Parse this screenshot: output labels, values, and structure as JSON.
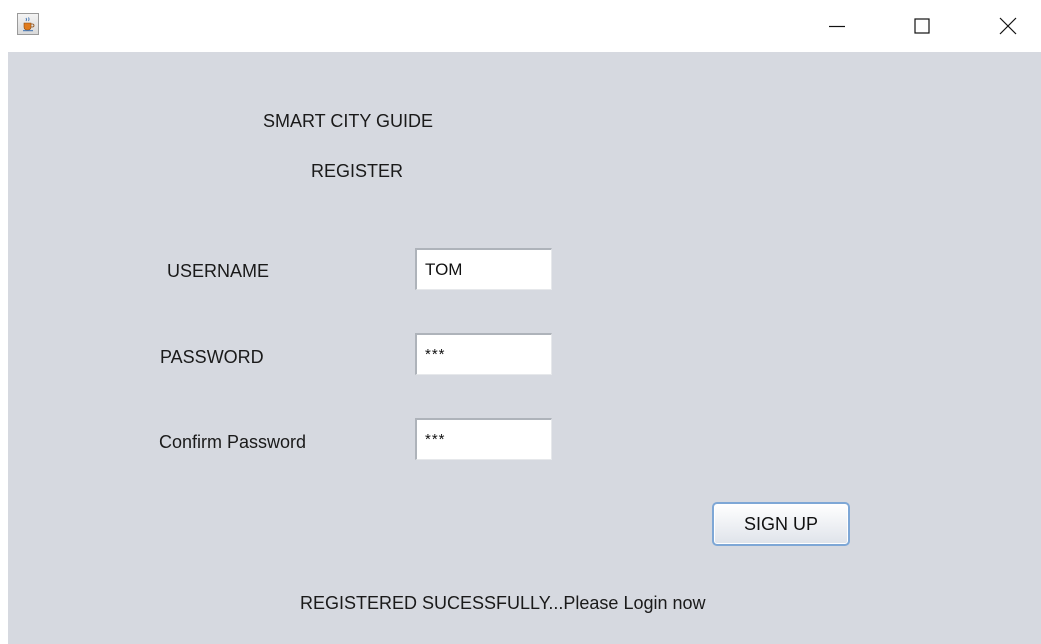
{
  "window": {
    "icon": "java-cup-icon",
    "controls": {
      "minimize": "minimize-icon",
      "maximize": "maximize-icon",
      "close": "close-icon"
    }
  },
  "form": {
    "app_title": "SMART CITY GUIDE",
    "heading": "REGISTER",
    "username_label": "USERNAME",
    "username_value": "TOM",
    "password_label": "PASSWORD",
    "password_value": "***",
    "confirm_label": "Confirm Password",
    "confirm_value": "***",
    "signup_label": "SIGN UP",
    "status_message": "REGISTERED SUCESSFULLY...Please Login now"
  },
  "colors": {
    "panel_background": "#d6d9e0",
    "button_focus_border": "#7ea7d6"
  }
}
